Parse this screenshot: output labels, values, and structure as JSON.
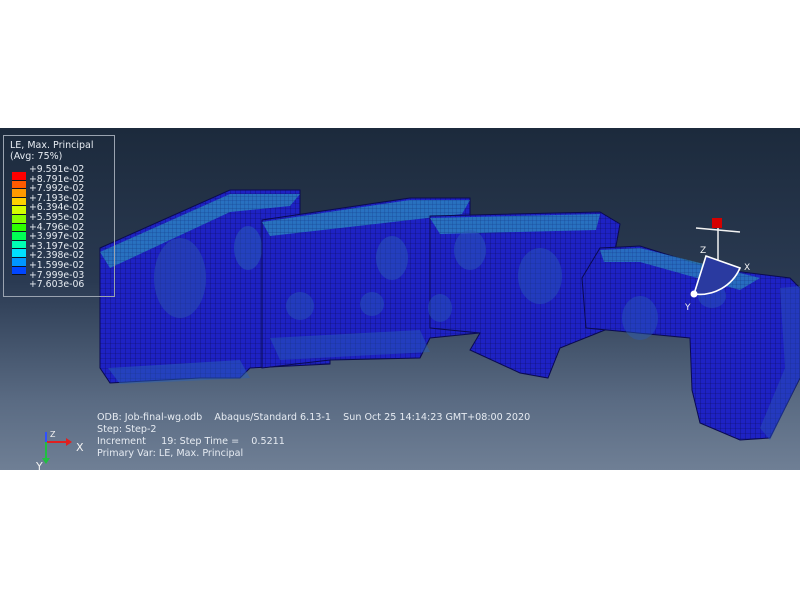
{
  "legend": {
    "title_line1": "LE, Max. Principal",
    "title_line2": "(Avg: 75%)",
    "entries": [
      {
        "value": "+9.591e-02",
        "color": "#ff0000"
      },
      {
        "value": "+8.791e-02",
        "color": "#ff5a00"
      },
      {
        "value": "+7.992e-02",
        "color": "#ff9a00"
      },
      {
        "value": "+7.193e-02",
        "color": "#ffd200"
      },
      {
        "value": "+6.394e-02",
        "color": "#d4ff00"
      },
      {
        "value": "+5.595e-02",
        "color": "#86ff00"
      },
      {
        "value": "+4.796e-02",
        "color": "#2cff00"
      },
      {
        "value": "+3.997e-02",
        "color": "#00ff55"
      },
      {
        "value": "+3.197e-02",
        "color": "#00ffb4"
      },
      {
        "value": "+2.398e-02",
        "color": "#00e0ff"
      },
      {
        "value": "+1.599e-02",
        "color": "#0096ff"
      },
      {
        "value": "+7.999e-03",
        "color": "#0046ff"
      },
      {
        "value": "+7.603e-06",
        "color": "#0000ff"
      }
    ]
  },
  "info": {
    "odb_line": "ODB: Job-final-wg.odb    Abaqus/Standard 6.13-1    Sun Oct 25 14:14:23 GMT+08:00 2020",
    "step_line": "Step: Step-2",
    "increment_line": "Increment     19: Step Time =    0.5211",
    "primary_var_line": "Primary Var: LE, Max. Principal"
  },
  "triad": {
    "x": "X",
    "y": "Y",
    "z": "Z"
  },
  "csys": {
    "x": "X",
    "y": "Y",
    "z": "Z"
  },
  "colors": {
    "mesh_blue": "#1c1cc8",
    "mesh_line": "#0a0a55",
    "strain_cyan": "#2ab8c8",
    "strain_green": "#3fd47a"
  }
}
